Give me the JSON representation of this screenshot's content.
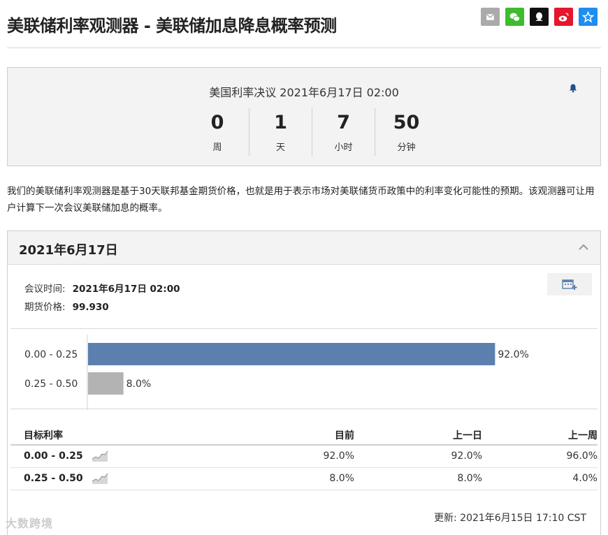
{
  "header": {
    "title": "美联储利率观测器 - 美联储加息降息概率预测",
    "share": [
      {
        "icon": "mail-icon",
        "color": "#aaaaaa"
      },
      {
        "icon": "wechat-icon",
        "color": "#3ebb2e"
      },
      {
        "icon": "qq-icon",
        "color": "#111111"
      },
      {
        "icon": "weibo-icon",
        "color": "#e6162d"
      },
      {
        "icon": "star-icon",
        "color": "#1e8ef0"
      }
    ]
  },
  "countdown": {
    "title": "美国利率决议 2021年6月17日 02:00",
    "units": [
      {
        "value": "0",
        "label": "周"
      },
      {
        "value": "1",
        "label": "天"
      },
      {
        "value": "7",
        "label": "小时"
      },
      {
        "value": "50",
        "label": "分钟"
      }
    ]
  },
  "description": "我们的美联储利率观测器是基于30天联邦基金期货价格，也就是用于表示市场对美联储货币政策中的利率变化可能性的预期。该观测器可让用户计算下一次会议美联储加息的概率。",
  "panel": {
    "date": "2021年6月17日",
    "meeting_label": "会议时间:",
    "meeting_value": "2021年6月17日 02:00",
    "futures_label": "期货价格:",
    "futures_value": "99.930"
  },
  "chart_data": {
    "type": "bar",
    "orientation": "horizontal",
    "categories": [
      "0.00 - 0.25",
      "0.25 - 0.50"
    ],
    "values": [
      92.0,
      8.0
    ],
    "value_labels": [
      "92.0%",
      "8.0%"
    ],
    "colors": [
      "#5b7fae",
      "#b3b3b3"
    ],
    "xlim": [
      0,
      100
    ]
  },
  "table": {
    "headers": [
      "目标利率",
      "目前",
      "上一日",
      "上一周"
    ],
    "rows": [
      {
        "rate": "0.00 - 0.25",
        "now": "92.0%",
        "prev_day": "92.0%",
        "prev_week": "96.0%"
      },
      {
        "rate": "0.25 - 0.50",
        "now": "8.0%",
        "prev_day": "8.0%",
        "prev_week": "4.0%"
      }
    ]
  },
  "updated": "更新: 2021年6月15日 17:10 CST",
  "watermark": "大数跨境"
}
